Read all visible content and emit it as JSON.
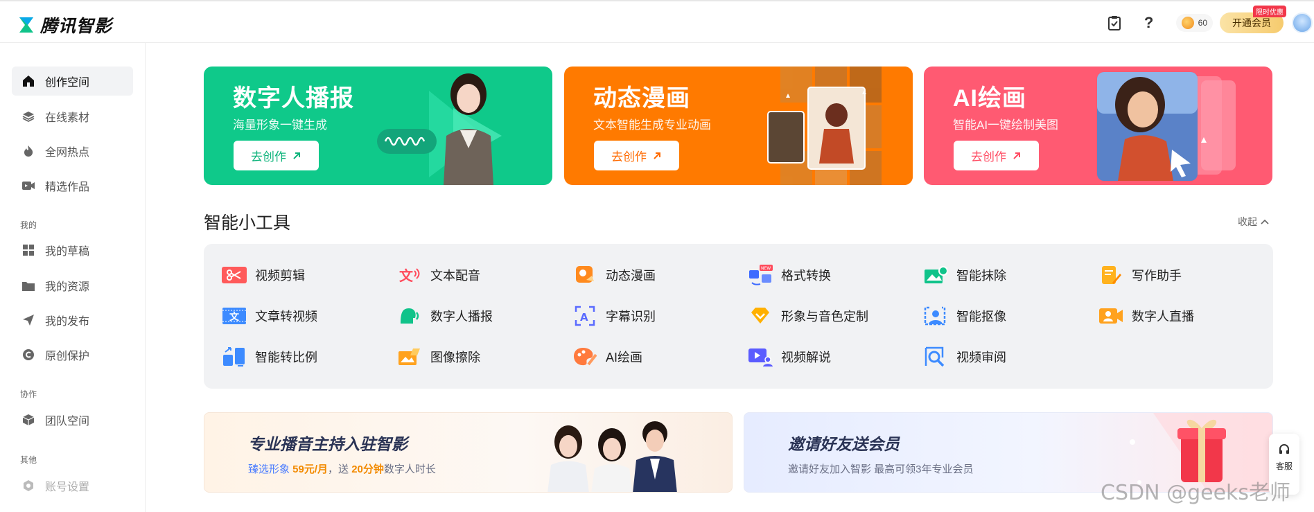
{
  "header": {
    "app_name": "腾讯智影",
    "coins": "60",
    "vip_label": "开通会员",
    "vip_tag": "限时优惠",
    "icons": [
      "clipboard-icon",
      "help-icon",
      "coin-icon",
      "avatar"
    ]
  },
  "sidebar": {
    "items": [
      {
        "label": "创作空间",
        "icon": "home-icon"
      },
      {
        "label": "在线素材",
        "icon": "layers-icon"
      },
      {
        "label": "全网热点",
        "icon": "flame-icon"
      },
      {
        "label": "精选作品",
        "icon": "video-icon"
      }
    ],
    "sec_mine": "我的",
    "mine": [
      {
        "label": "我的草稿",
        "icon": "grid-icon"
      },
      {
        "label": "我的资源",
        "icon": "folder-icon"
      },
      {
        "label": "我的发布",
        "icon": "send-icon"
      },
      {
        "label": "原创保护",
        "icon": "copyright-icon"
      }
    ],
    "sec_collab": "协作",
    "collab": [
      {
        "label": "团队空间",
        "icon": "cube-icon"
      }
    ],
    "sec_other": "其他",
    "other": [
      {
        "label": "账号设置",
        "icon": "settings-icon"
      }
    ]
  },
  "banners": [
    {
      "title": "数字人播报",
      "subtitle": "海量形象一键生成",
      "button": "去创作",
      "color": "#0fc98a",
      "btn_color": "#0fb47c"
    },
    {
      "title": "动态漫画",
      "subtitle": "文本智能生成专业动画",
      "button": "去创作",
      "color": "#ff7a00",
      "btn_color": "#ff6a00"
    },
    {
      "title": "AI绘画",
      "subtitle": "智能AI一键绘制美图",
      "button": "去创作",
      "color": "#ff5a72",
      "btn_color": "#ff4d64"
    }
  ],
  "tools": {
    "title": "智能小工具",
    "collapse": "收起",
    "items": [
      {
        "label": "视频剪辑",
        "icon": "scissors-icon",
        "color": "#ff5a5a"
      },
      {
        "label": "文本配音",
        "icon": "text-voice-icon",
        "color": "#ff5a5a"
      },
      {
        "label": "动态漫画",
        "icon": "comic-icon",
        "color": "#ff8a1e"
      },
      {
        "label": "格式转换",
        "icon": "convert-icon",
        "color": "#3d6bff"
      },
      {
        "label": "智能抹除",
        "icon": "erase-icon",
        "color": "#10c38a"
      },
      {
        "label": "写作助手",
        "icon": "write-icon",
        "color": "#ffb21e"
      },
      {
        "label": "文章转视频",
        "icon": "article-video-icon",
        "color": "#3d8bff"
      },
      {
        "label": "数字人播报",
        "icon": "avatar-broadcast-icon",
        "color": "#10c38a"
      },
      {
        "label": "字幕识别",
        "icon": "subtitle-icon",
        "color": "#5a6bff"
      },
      {
        "label": "形象与音色定制",
        "icon": "diamond-icon",
        "color": "#ffb000"
      },
      {
        "label": "智能抠像",
        "icon": "matting-icon",
        "color": "#3d8bff"
      },
      {
        "label": "数字人直播",
        "icon": "live-icon",
        "color": "#ffa21e"
      },
      {
        "label": "智能转比例",
        "icon": "ratio-icon",
        "color": "#3d8bff"
      },
      {
        "label": "图像擦除",
        "icon": "image-erase-icon",
        "color": "#ffa21e"
      },
      {
        "label": "AI绘画",
        "icon": "palette-icon",
        "color": "#ff7a3d"
      },
      {
        "label": "视频解说",
        "icon": "narration-icon",
        "color": "#5a5bff"
      },
      {
        "label": "视频审阅",
        "icon": "review-icon",
        "color": "#3d8bff"
      }
    ],
    "new_badge": "NEW"
  },
  "promos": [
    {
      "title": "专业播音主持入驻智影",
      "sub_a": "臻选形象 ",
      "price": "59元/月",
      "sub_b": "，送 ",
      "minutes": "20分钟",
      "sub_c": "数字人时长"
    },
    {
      "title": "邀请好友送会员",
      "sub": "邀请好友加入智影 最高可领3年专业会员"
    }
  ],
  "help": {
    "label": "客服"
  },
  "watermark": "CSDN @geeks老师"
}
